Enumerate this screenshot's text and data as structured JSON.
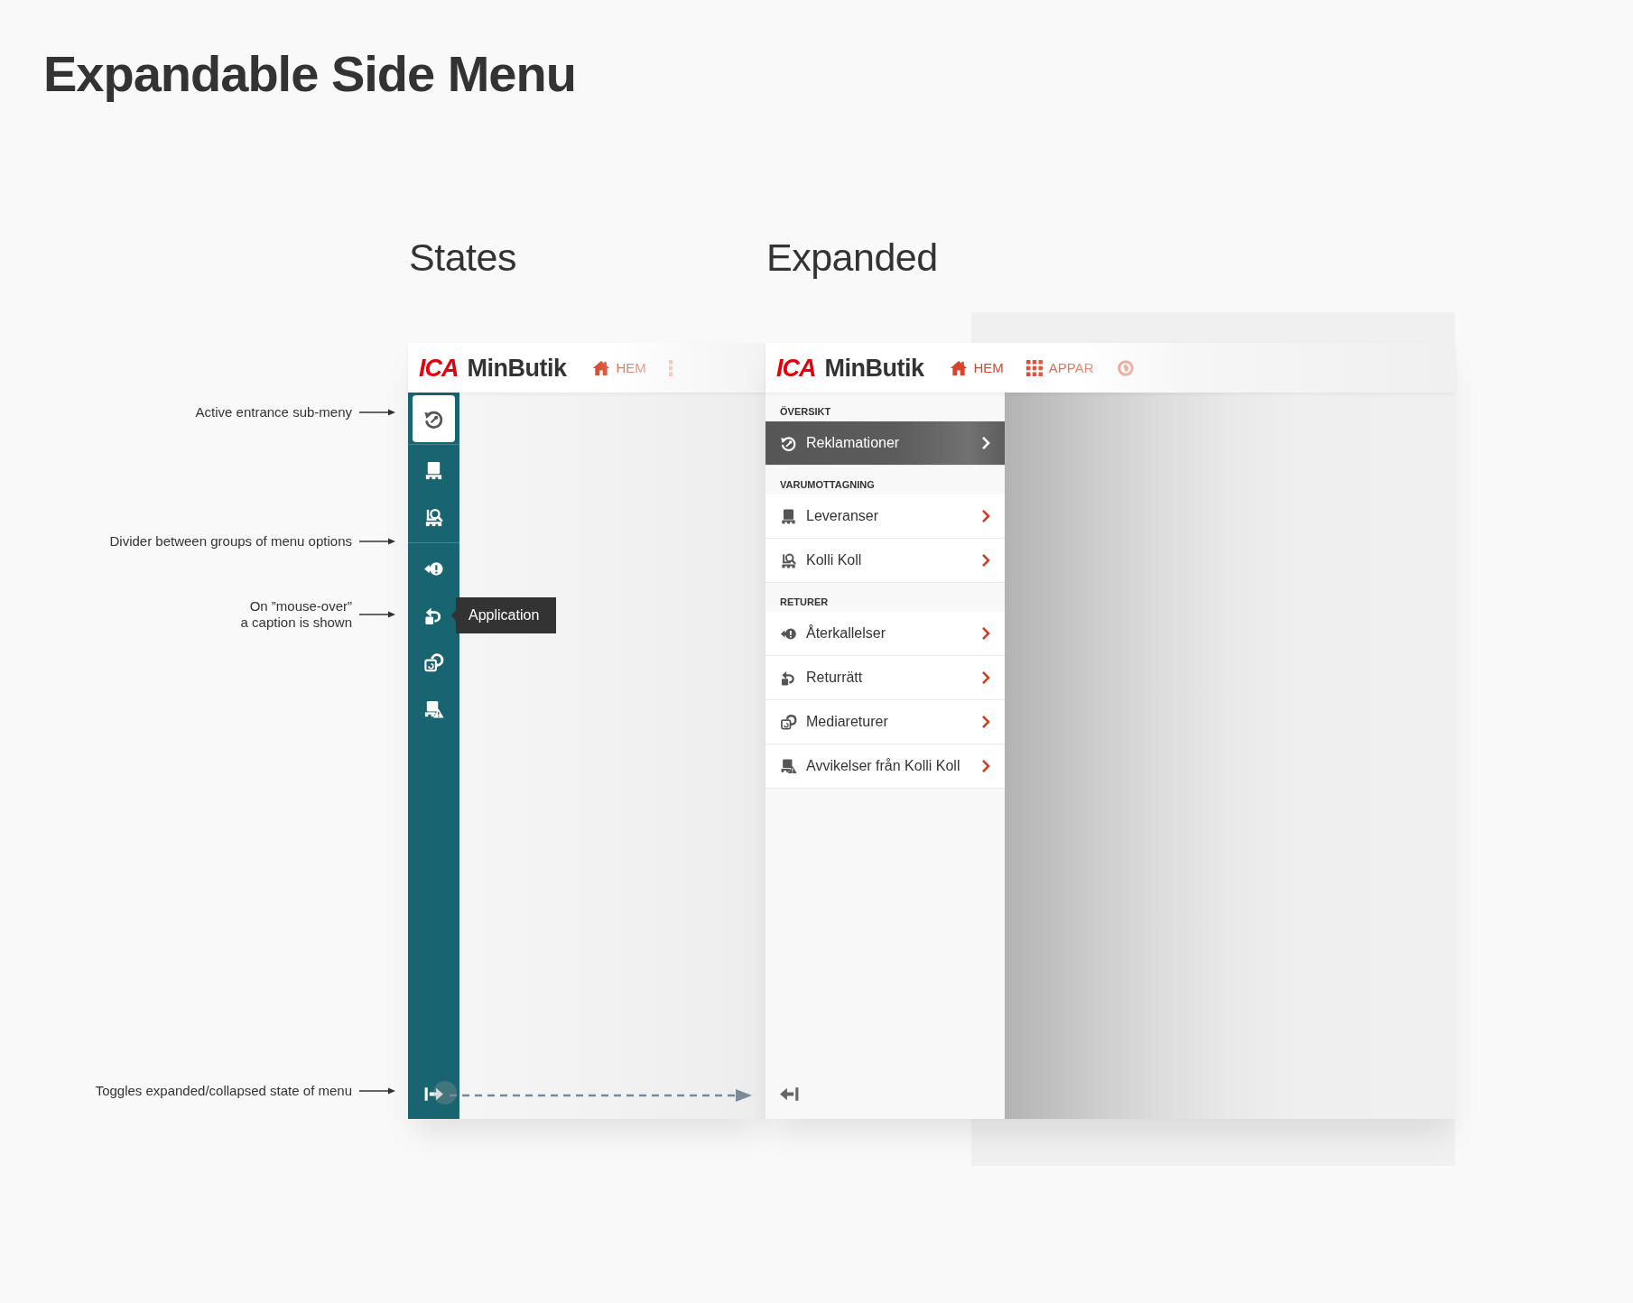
{
  "title": "Expandable Side Menu",
  "annotations": [
    {
      "text": "Active entrance sub-meny"
    },
    {
      "text": "Divider between groups of menu options"
    },
    {
      "text": "On ”mouse-over”\na caption is shown"
    },
    {
      "text": "Toggles expanded/collapsed state of menu"
    }
  ],
  "panels": [
    {
      "heading": "States",
      "header": {
        "logo": "ICA",
        "app_name": "MinButik",
        "nav": [
          {
            "kind": "home",
            "label": "HEM"
          },
          {
            "kind": "apps"
          }
        ]
      },
      "menu": {
        "expanded": false,
        "groups": [
          {
            "items": [
              {
                "kind": "complaints",
                "selected": true
              }
            ]
          },
          {
            "items": [
              {
                "kind": "deliveries",
                "selected": false
              },
              {
                "kind": "inspection",
                "selected": false
              }
            ]
          },
          {
            "items": [
              {
                "kind": "recalls",
                "selected": false
              },
              {
                "kind": "returns",
                "selected": false,
                "tooltip": "Application"
              },
              {
                "kind": "media",
                "selected": false
              },
              {
                "kind": "deviations",
                "selected": false
              }
            ]
          }
        ]
      }
    },
    {
      "heading": "Expanded",
      "header": {
        "logo": "ICA",
        "app_name": "MinButik",
        "nav": [
          {
            "kind": "home",
            "label": "HEM"
          },
          {
            "kind": "apps",
            "label": "APPAR"
          },
          {
            "kind": "profile"
          }
        ]
      },
      "menu": {
        "expanded": true,
        "groups": [
          {
            "heading": "ÖVERSIKT",
            "items": [
              {
                "kind": "complaints",
                "label": "Reklamationer",
                "selected": true
              }
            ]
          },
          {
            "heading": "VARUMOTTAGNING",
            "items": [
              {
                "kind": "deliveries",
                "label": "Leveranser",
                "selected": false
              },
              {
                "kind": "inspection",
                "label": "Kolli Koll",
                "selected": false
              }
            ]
          },
          {
            "heading": "RETURER",
            "items": [
              {
                "kind": "recalls",
                "label": "Återkallelser",
                "selected": false
              },
              {
                "kind": "returns",
                "label": "Returrätt",
                "selected": false
              },
              {
                "kind": "media",
                "label": "Mediareturer",
                "selected": false
              },
              {
                "kind": "deviations",
                "label": "Avvikelser från Kolli Koll",
                "selected": false
              }
            ]
          }
        ]
      }
    }
  ]
}
